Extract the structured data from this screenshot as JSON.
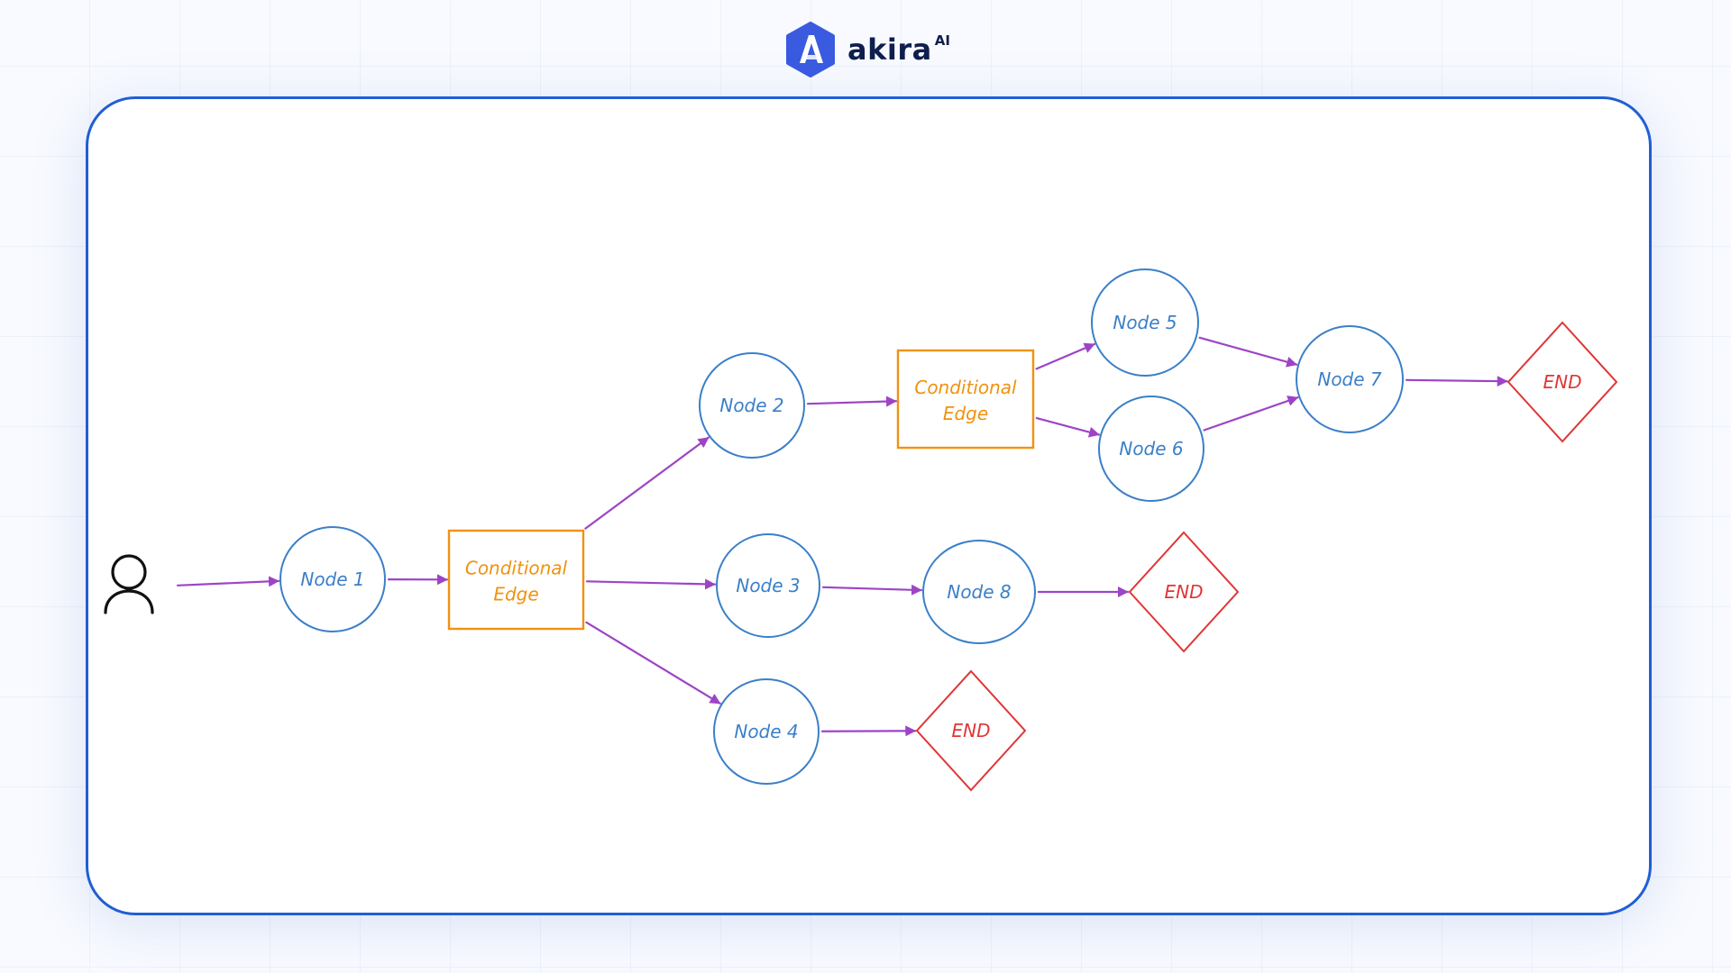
{
  "brand": {
    "name": "akira",
    "suffix": "AI",
    "logo_icon": "akira-hexagon-logo-icon",
    "colors": {
      "mark": "#3a5be0",
      "text": "#0f1f4d",
      "frame_border": "#1f5fd6"
    }
  },
  "diagram": {
    "colors": {
      "node": "#3b7fc8",
      "conditional": "#f0920f",
      "end": "#e03535",
      "arrow": "#9d44c6",
      "user": "#111111"
    },
    "start": {
      "id": "user",
      "icon": "user-icon",
      "label": "User"
    },
    "nodes": [
      {
        "id": "n1",
        "type": "node",
        "label": "Node 1"
      },
      {
        "id": "c1",
        "type": "conditional",
        "label_lines": [
          "Conditional",
          "Edge"
        ]
      },
      {
        "id": "n2",
        "type": "node",
        "label": "Node 2"
      },
      {
        "id": "n3",
        "type": "node",
        "label": "Node 3"
      },
      {
        "id": "n4",
        "type": "node",
        "label": "Node 4"
      },
      {
        "id": "c2",
        "type": "conditional",
        "label_lines": [
          "Conditional",
          "Edge"
        ]
      },
      {
        "id": "n5",
        "type": "node",
        "label": "Node 5"
      },
      {
        "id": "n6",
        "type": "node",
        "label": "Node 6"
      },
      {
        "id": "n7",
        "type": "node",
        "label": "Node 7"
      },
      {
        "id": "n8",
        "type": "node",
        "label": "Node 8"
      },
      {
        "id": "e1",
        "type": "end",
        "label": "END"
      },
      {
        "id": "e2",
        "type": "end",
        "label": "END"
      },
      {
        "id": "e3",
        "type": "end",
        "label": "END"
      }
    ],
    "edges": [
      [
        "user",
        "n1"
      ],
      [
        "n1",
        "c1"
      ],
      [
        "c1",
        "n2"
      ],
      [
        "c1",
        "n3"
      ],
      [
        "c1",
        "n4"
      ],
      [
        "n2",
        "c2"
      ],
      [
        "c2",
        "n5"
      ],
      [
        "c2",
        "n6"
      ],
      [
        "n5",
        "n7"
      ],
      [
        "n6",
        "n7"
      ],
      [
        "n7",
        "e1"
      ],
      [
        "n3",
        "n8"
      ],
      [
        "n8",
        "e2"
      ],
      [
        "n4",
        "e3"
      ]
    ]
  }
}
